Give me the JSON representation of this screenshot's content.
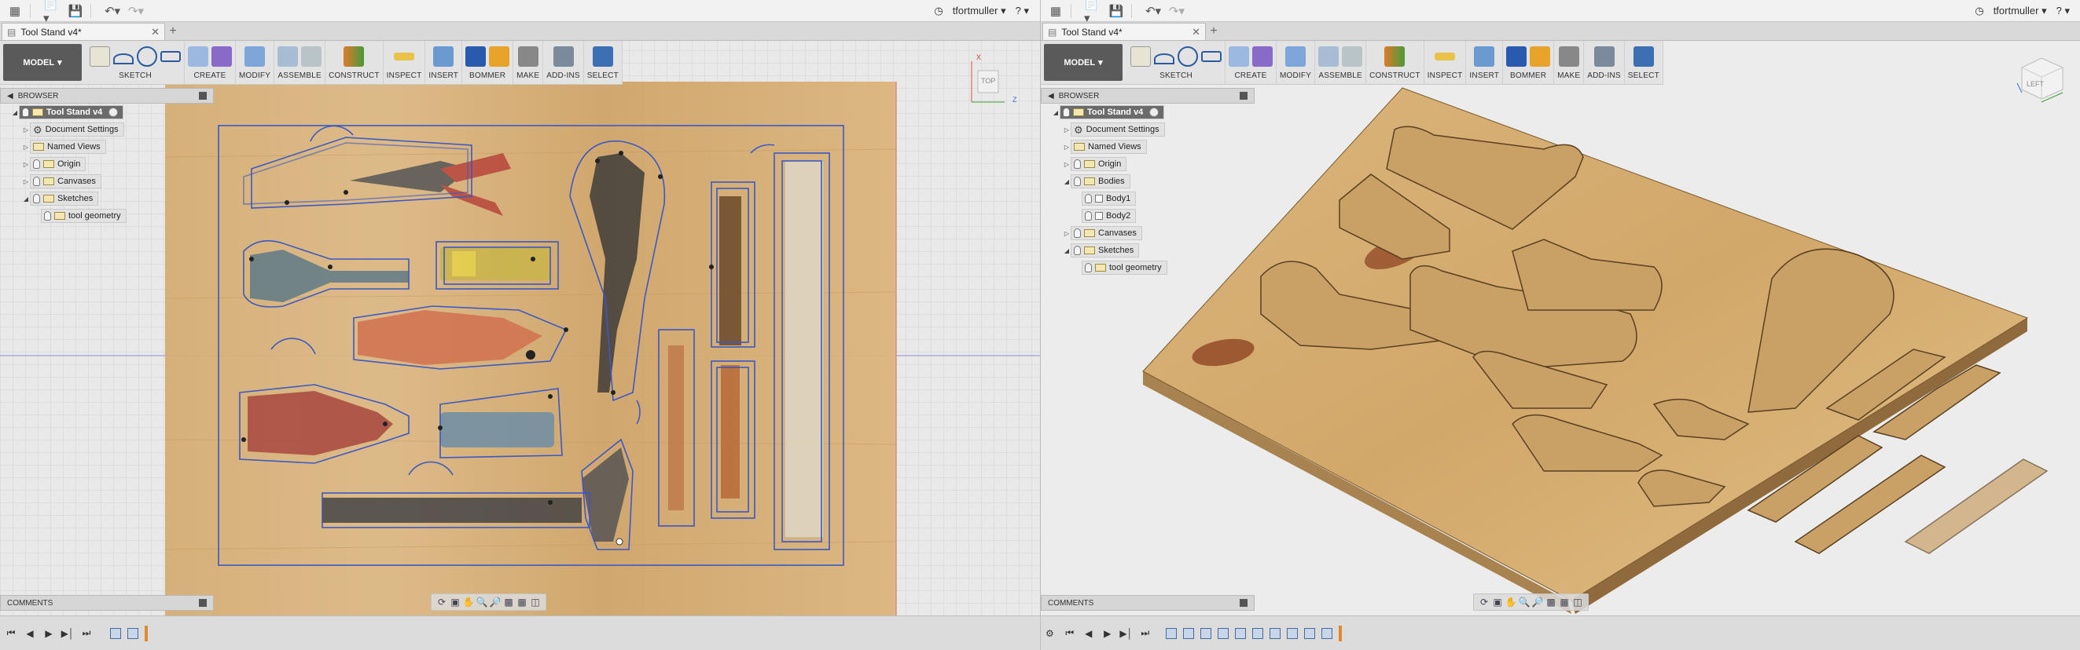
{
  "app": {
    "user": "tfortmuller",
    "help": "?"
  },
  "left": {
    "tab_title": "Tool Stand v4*",
    "mode": "MODEL",
    "toolbar": [
      "SKETCH",
      "CREATE",
      "MODIFY",
      "ASSEMBLE",
      "CONSTRUCT",
      "INSPECT",
      "INSERT",
      "BOMMER",
      "MAKE",
      "ADD-INS",
      "SELECT"
    ],
    "browser_title": "BROWSER",
    "tree": [
      {
        "label": "Tool Stand v4",
        "level": 0,
        "kind": "root"
      },
      {
        "label": "Document Settings",
        "level": 1,
        "kind": "gear"
      },
      {
        "label": "Named Views",
        "level": 1,
        "kind": "folder"
      },
      {
        "label": "Origin",
        "level": 1,
        "kind": "bulb-folder"
      },
      {
        "label": "Canvases",
        "level": 1,
        "kind": "bulb-folder"
      },
      {
        "label": "Sketches",
        "level": 1,
        "kind": "bulb-folder",
        "expanded": true
      },
      {
        "label": "tool geometry",
        "level": 2,
        "kind": "bulb-sketch"
      }
    ],
    "comments_title": "COMMENTS",
    "viewcube": {
      "face": "TOP",
      "x": "X",
      "z": "Z"
    }
  },
  "right": {
    "tab_title": "Tool Stand v4*",
    "mode": "MODEL",
    "toolbar": [
      "SKETCH",
      "CREATE",
      "MODIFY",
      "ASSEMBLE",
      "CONSTRUCT",
      "INSPECT",
      "INSERT",
      "BOMMER",
      "MAKE",
      "ADD-INS",
      "SELECT"
    ],
    "browser_title": "BROWSER",
    "tree": [
      {
        "label": "Tool Stand v4",
        "level": 0,
        "kind": "root"
      },
      {
        "label": "Document Settings",
        "level": 1,
        "kind": "gear"
      },
      {
        "label": "Named Views",
        "level": 1,
        "kind": "folder"
      },
      {
        "label": "Origin",
        "level": 1,
        "kind": "bulb-folder"
      },
      {
        "label": "Bodies",
        "level": 1,
        "kind": "bulb-folder",
        "expanded": true
      },
      {
        "label": "Body1",
        "level": 2,
        "kind": "body"
      },
      {
        "label": "Body2",
        "level": 2,
        "kind": "body"
      },
      {
        "label": "Canvases",
        "level": 1,
        "kind": "bulb-folder"
      },
      {
        "label": "Sketches",
        "level": 1,
        "kind": "bulb-folder",
        "expanded": true
      },
      {
        "label": "tool geometry",
        "level": 2,
        "kind": "bulb-sketch"
      }
    ],
    "comments_title": "COMMENTS",
    "viewcube": {
      "face": "LEFT"
    }
  },
  "colors": {
    "sketch_line": "#3b58c4",
    "wood_light": "#d9b37a",
    "wood_dark": "#b98a4e",
    "accent_select": "#3d6fb3"
  },
  "icons": {
    "toolbar": [
      "sketch-icon",
      "arc-icon",
      "circle-icon",
      "rectangle-icon",
      "extrude-icon",
      "pattern-icon",
      "press-pull-icon",
      "joint-icon",
      "as-built-joint-icon",
      "offset-plane-icon",
      "measure-icon",
      "insert-image-icon",
      "bommer-icon",
      "bommer-edit-icon",
      "make-3d-print-icon",
      "scripts-icon",
      "select-icon"
    ]
  }
}
